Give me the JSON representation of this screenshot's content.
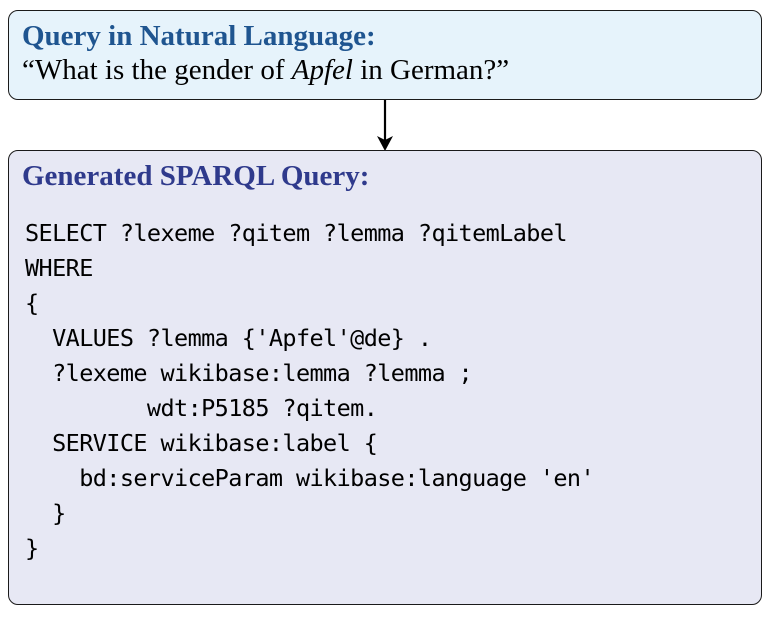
{
  "nl_box": {
    "title": "Query in Natural Language:",
    "text_before": "“What is the gender of ",
    "text_italic": "Apfel",
    "text_after": " in German?”"
  },
  "sparql_box": {
    "title": "Generated SPARQL Query:",
    "code_lines": [
      "SELECT ?lexeme ?qitem ?lemma ?qitemLabel",
      "WHERE",
      "{",
      "  VALUES ?lemma {'Apfel'@de} .",
      "  ?lexeme wikibase:lemma ?lemma ;",
      "         wdt:P5185 ?qitem.",
      "  SERVICE wikibase:label {",
      "    bd:serviceParam wikibase:language 'en'",
      "  }",
      "}"
    ]
  },
  "colors": {
    "nl_box_fill": "#e6f3fb",
    "sparql_box_fill": "#e7e8f4",
    "nl_title": "#1f5590",
    "sparql_title": "#2f3a8c"
  }
}
